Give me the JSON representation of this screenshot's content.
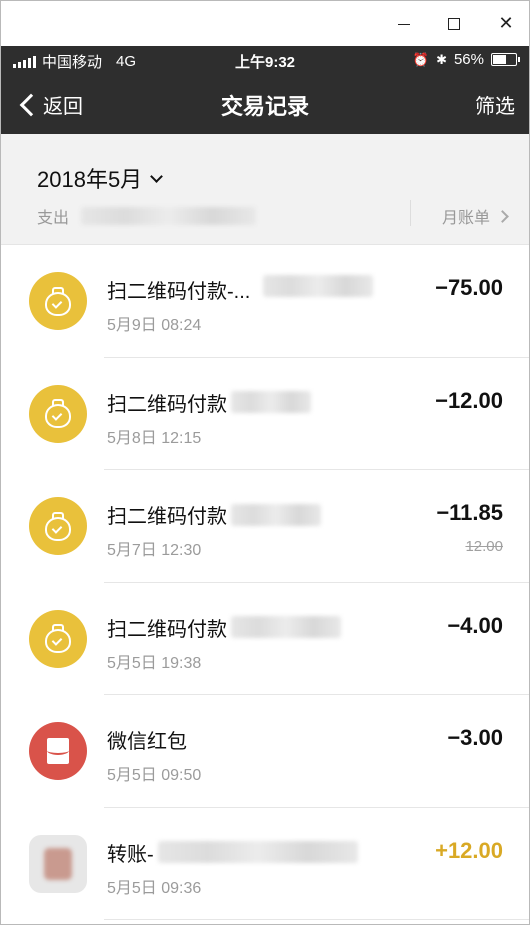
{
  "window_controls": {
    "minimize": "—",
    "maximize": "☐",
    "close": "✕"
  },
  "status_bar": {
    "carrier": "中国移动",
    "network": "4G",
    "time": "上午9:32",
    "alarm_icon": "⏰",
    "bluetooth_icon": "✱",
    "battery": "56%"
  },
  "nav": {
    "back_label": "返回",
    "title": "交易记录",
    "filter_label": "筛选"
  },
  "summary": {
    "month": "2018年5月",
    "spend_label": "支出",
    "monthly_bill_label": "月账单"
  },
  "transactions": [
    {
      "icon": "wallet-pay-icon",
      "title": "扫二维码付款-...",
      "date": "5月9日 08:24",
      "amount": "−75.00",
      "original": ""
    },
    {
      "icon": "wallet-pay-icon",
      "title": "扫二维码付款",
      "date": "5月8日 12:15",
      "amount": "−12.00",
      "original": ""
    },
    {
      "icon": "wallet-pay-icon",
      "title": "扫二维码付款",
      "date": "5月7日 12:30",
      "amount": "−11.85",
      "original": "12.00"
    },
    {
      "icon": "wallet-pay-icon",
      "title": "扫二维码付款",
      "date": "5月5日 19:38",
      "amount": "−4.00",
      "original": ""
    },
    {
      "icon": "red-envelope-icon",
      "title": "微信红包",
      "date": "5月5日 09:50",
      "amount": "−3.00",
      "original": ""
    },
    {
      "icon": "user-avatar",
      "title": "转账-",
      "date": "5月5日 09:36",
      "amount": "+12.00",
      "original": ""
    }
  ],
  "colors": {
    "header_bg": "#2e2e2e",
    "pay_icon": "#e9c13b",
    "red_envelope": "#d9534a",
    "income": "#d9a925"
  }
}
